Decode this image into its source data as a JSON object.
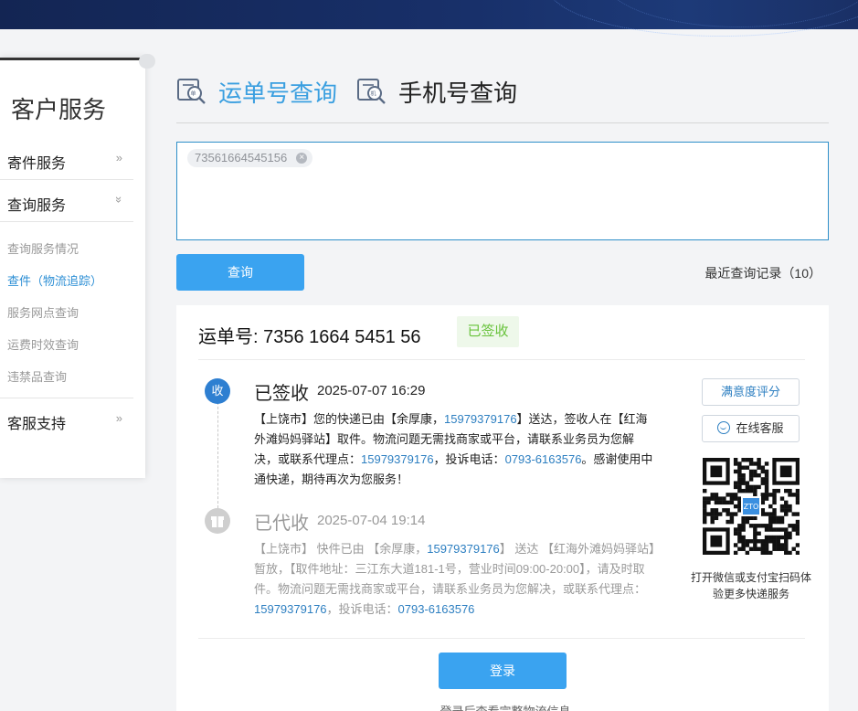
{
  "sidebar": {
    "title": "客户服务",
    "menus": [
      {
        "label": "寄件服务",
        "chevron": "»"
      },
      {
        "label": "查询服务",
        "chevron": "»"
      },
      {
        "label": "客服支持",
        "chevron": "»"
      }
    ],
    "sub_items": [
      "查询服务情况",
      "查件（物流追踪）",
      "服务网点查询",
      "运费时效查询",
      "违禁品查询"
    ]
  },
  "tabs": {
    "waybill": "运单号查询",
    "phone": "手机号查询"
  },
  "query": {
    "tag": "73561664545156",
    "button": "查询",
    "recent": "最近查询记录（10）"
  },
  "result": {
    "waybill_label": "运单号: 7356 1664 5451 56",
    "status_badge": "已签收",
    "events": [
      {
        "node": "收",
        "title": "已签收",
        "time": "2025-07-07 16:29",
        "body": [
          {
            "t": "【上饶市】您的快递已由【余厚康，"
          },
          {
            "t": "15979379176",
            "phone": true
          },
          {
            "t": "】送达，签收人在【红海外滩妈妈驿站】取件。物流问题无需找商家或平台，请联系业务员为您解决，或联系代理点："
          },
          {
            "t": "15979379176",
            "phone": true
          },
          {
            "t": "，投诉电话："
          },
          {
            "t": "0793-6163576",
            "phone": true
          },
          {
            "t": "。感谢使用中通快递，期待再次为您服务！"
          }
        ]
      },
      {
        "node": "gift-icon",
        "title": "已代收",
        "time": "2025-07-04 19:14",
        "body": [
          {
            "t": "【上饶市】 快件已由 【余厚康，"
          },
          {
            "t": "15979379176",
            "phone": true
          },
          {
            "t": "】 送达 【红海外滩妈妈驿站】暂放，【取件地址：三江东大道181-1号，营业时间09:00-20:00】，请及时取件。物流问题无需找商家或平台，请联系业务员为您解决，或联系代理点："
          },
          {
            "t": "15979379176",
            "phone": true
          },
          {
            "t": "，投诉电话："
          },
          {
            "t": "0793-6163576",
            "phone": true
          }
        ]
      }
    ],
    "rating_button": "满意度评分",
    "service_button": "在线客服",
    "qr_caption": "打开微信或支付宝扫码体验更多快递服务",
    "qr_logo": "ZTO",
    "login_button": "登录",
    "login_hint": "登录后查看完整物流信息"
  },
  "colors": {
    "accent": "#3aa3f0",
    "link": "#2d7fc1",
    "success": "#67c23a",
    "topbar": "#18306a"
  }
}
